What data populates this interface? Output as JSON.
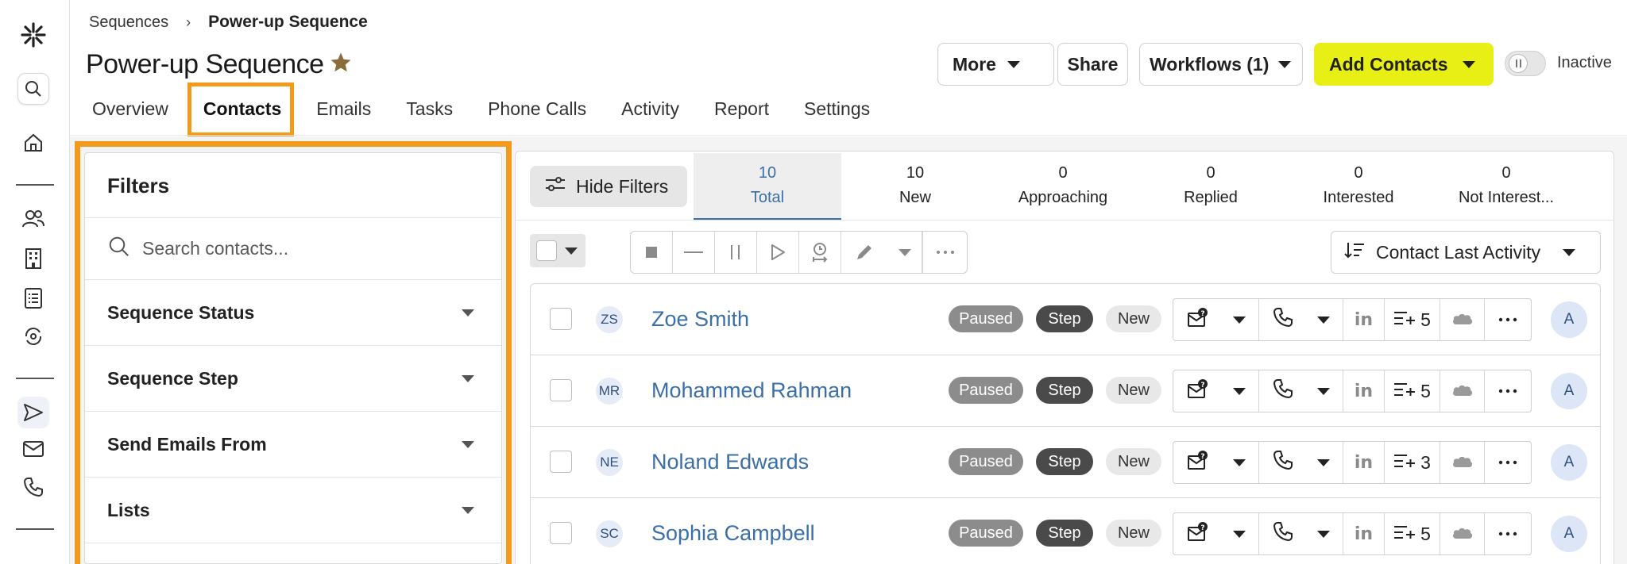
{
  "breadcrumb": {
    "parent": "Sequences",
    "current": "Power-up Sequence"
  },
  "page": {
    "title": "Power-up Sequence"
  },
  "header": {
    "more_label": "More",
    "share_label": "Share",
    "workflows_label": "Workflows (1)",
    "add_contacts_label": "Add Contacts",
    "status_label": "Inactive"
  },
  "tabs": [
    {
      "label": "Overview"
    },
    {
      "label": "Contacts"
    },
    {
      "label": "Emails"
    },
    {
      "label": "Tasks"
    },
    {
      "label": "Phone Calls"
    },
    {
      "label": "Activity"
    },
    {
      "label": "Report"
    },
    {
      "label": "Settings"
    }
  ],
  "filters": {
    "title": "Filters",
    "search_placeholder": "Search contacts...",
    "items": [
      {
        "label": "Sequence Status"
      },
      {
        "label": "Sequence Step"
      },
      {
        "label": "Send Emails From"
      },
      {
        "label": "Lists"
      }
    ]
  },
  "main": {
    "hide_filters_label": "Hide Filters",
    "stats": [
      {
        "value": "10",
        "label": "Total"
      },
      {
        "value": "10",
        "label": "New"
      },
      {
        "value": "0",
        "label": "Approaching"
      },
      {
        "value": "0",
        "label": "Replied"
      },
      {
        "value": "0",
        "label": "Interested"
      },
      {
        "value": "0",
        "label": "Not Interest..."
      }
    ],
    "sort_label": "Contact Last Activity"
  },
  "contacts": [
    {
      "initials": "ZS",
      "name": "Zoe Smith",
      "status": "Paused",
      "step": "Step",
      "stage": "New",
      "count": "5",
      "owner": "A"
    },
    {
      "initials": "MR",
      "name": "Mohammed Rahman",
      "status": "Paused",
      "step": "Step",
      "stage": "New",
      "count": "5",
      "owner": "A"
    },
    {
      "initials": "NE",
      "name": "Noland Edwards",
      "status": "Paused",
      "step": "Step",
      "stage": "New",
      "count": "3",
      "owner": "A"
    },
    {
      "initials": "SC",
      "name": "Sophia Campbell",
      "status": "Paused",
      "step": "Step",
      "stage": "New",
      "count": "5",
      "owner": "A"
    }
  ],
  "colors": {
    "accent": "#f39a1a",
    "primary_button": "#e8ef14",
    "link": "#3a6fa8"
  },
  "icons": [
    "app-logo-icon",
    "search-icon",
    "home-icon",
    "people-icon",
    "building-icon",
    "list-icon",
    "sync-icon",
    "send-icon",
    "mail-icon",
    "phone-icon",
    "star-icon",
    "linkedin-icon",
    "salesforce-icon"
  ]
}
